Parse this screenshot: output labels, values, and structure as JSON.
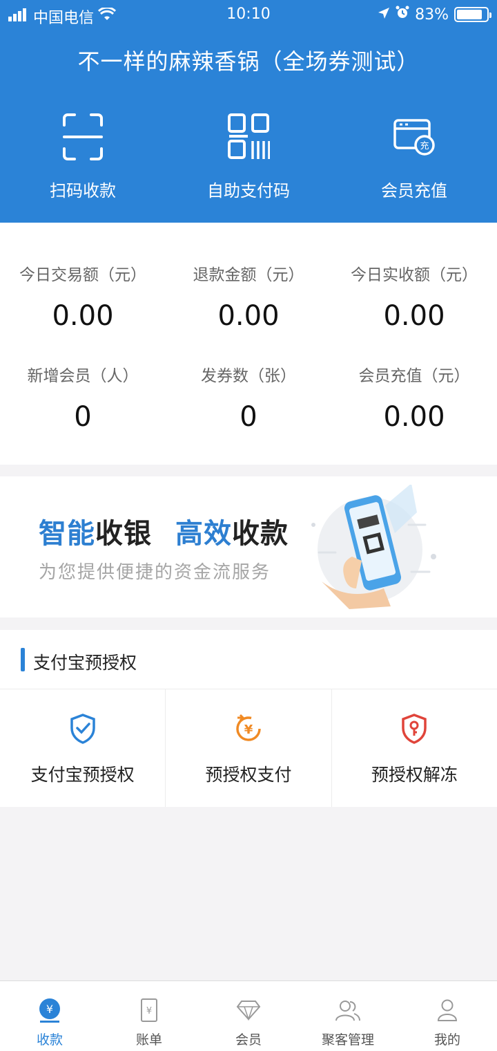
{
  "status_bar": {
    "carrier": "中国电信",
    "time": "10:10",
    "battery": "83%"
  },
  "header": {
    "title": "不一样的麻辣香锅（全场券测试）"
  },
  "actions": [
    {
      "label": "扫码收款",
      "icon": "scan-icon"
    },
    {
      "label": "自助支付码",
      "icon": "qrcode-icon"
    },
    {
      "label": "会员充值",
      "icon": "card-recharge-icon"
    }
  ],
  "stats": [
    {
      "label": "今日交易额（元）",
      "value": "0.00"
    },
    {
      "label": "退款金额（元）",
      "value": "0.00"
    },
    {
      "label": "今日实收额（元）",
      "value": "0.00"
    },
    {
      "label": "新增会员（人）",
      "value": "0"
    },
    {
      "label": "发券数（张）",
      "value": "0"
    },
    {
      "label": "会员充值（元）",
      "value": "0.00"
    }
  ],
  "banner": {
    "h1_blue": "智能",
    "h1_dark": "收银",
    "h2_blue": "高效",
    "h2_dark": "收款",
    "subtitle": "为您提供便捷的资金流服务"
  },
  "preauth": {
    "title": "支付宝预授权",
    "items": [
      {
        "label": "支付宝预授权",
        "icon": "shield-check-icon",
        "color": "#2b83d7"
      },
      {
        "label": "预授权支付",
        "icon": "yuan-refresh-icon",
        "color": "#f08a24"
      },
      {
        "label": "预授权解冻",
        "icon": "shield-key-icon",
        "color": "#e0443a"
      }
    ]
  },
  "tabbar": [
    {
      "label": "收款",
      "icon": "yuan-tab-icon",
      "active": true
    },
    {
      "label": "账单",
      "icon": "bill-icon",
      "active": false
    },
    {
      "label": "会员",
      "icon": "diamond-icon",
      "active": false
    },
    {
      "label": "聚客管理",
      "icon": "users-icon",
      "active": false
    },
    {
      "label": "我的",
      "icon": "person-icon",
      "active": false
    }
  ],
  "colors": {
    "primary": "#2b83d7",
    "background": "#f4f3f5"
  }
}
